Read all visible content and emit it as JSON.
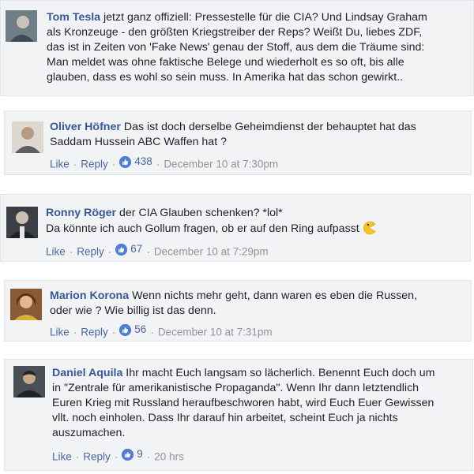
{
  "comments": [
    {
      "author": "Tom Tesla",
      "lines": [
        "jetzt ganz offiziell: Pressestelle für die CIA? Und Lindsay Graham",
        "als Kronzeuge - den größten Kriegstreiber der Reps? Weißt Du, liebes ZDF,",
        "das ist in Zeiten von 'Fake News' genau der Stoff, aus dem die Träume sind:",
        "Man meldet was ohne faktische Belege und wiederholt es so oft, bis alle",
        "glauben, dass es wohl so sein muss. In Amerika hat das schon gewirkt.."
      ]
    },
    {
      "author": "Oliver Höfner",
      "lines": [
        "Das ist doch derselbe Geheimdienst der behauptet hat das",
        "Saddam Hussein ABC Waffen hat ?"
      ],
      "like_label": "Like",
      "reply_label": "Reply",
      "likes": "438",
      "time": "December 10 at 7:30pm"
    },
    {
      "author": "Ronny Röger",
      "lines": [
        "der CIA Glauben schenken? *lol*",
        "Da könnte ich auch Gollum fragen, ob er auf den Ring aufpasst"
      ],
      "emoji": "pacman-emoticon",
      "like_label": "Like",
      "reply_label": "Reply",
      "likes": "67",
      "time": "December 10 at 7:29pm"
    },
    {
      "author": "Marion Korona",
      "lines": [
        "Wenn nichts mehr geht, dann waren es eben die Russen,",
        "oder wie ? Wie billig ist das denn."
      ],
      "like_label": "Like",
      "reply_label": "Reply",
      "likes": "56",
      "time": "December 10 at 7:31pm"
    },
    {
      "author": "Daniel Aquila",
      "lines": [
        "Ihr macht Euch langsam so lächerlich. Benennt Euch doch um",
        "in \"Zentrale für amerikanistische Propaganda\". Wenn Ihr dann letztendlich",
        "Euren Krieg mit Russland heraufbeschworen habt, wird Euch Euer Gewissen",
        "vllt. noch einholen. Dass Ihr darauf hin arbeitet, scheint Euch ja nichts",
        "auszumachen."
      ],
      "like_label": "Like",
      "reply_label": "Reply",
      "likes": "9",
      "time": "20 hrs"
    }
  ],
  "colors": {
    "card_bg": "#f2f3f5",
    "author": "#365899",
    "link": "#4b67a1",
    "meta": "#90949c",
    "like_badge": "#4f7cd7"
  }
}
